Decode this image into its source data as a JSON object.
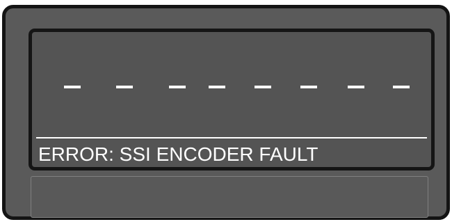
{
  "display": {
    "digits": [
      "–",
      "–",
      "–",
      "–",
      "–",
      "–",
      "–",
      "–"
    ],
    "message": "ERROR: SSI ENCODER FAULT"
  },
  "colors": {
    "housing": "#5a5a5a",
    "bezel": "#141414",
    "screen": "#545454",
    "text": "#ffffff"
  }
}
